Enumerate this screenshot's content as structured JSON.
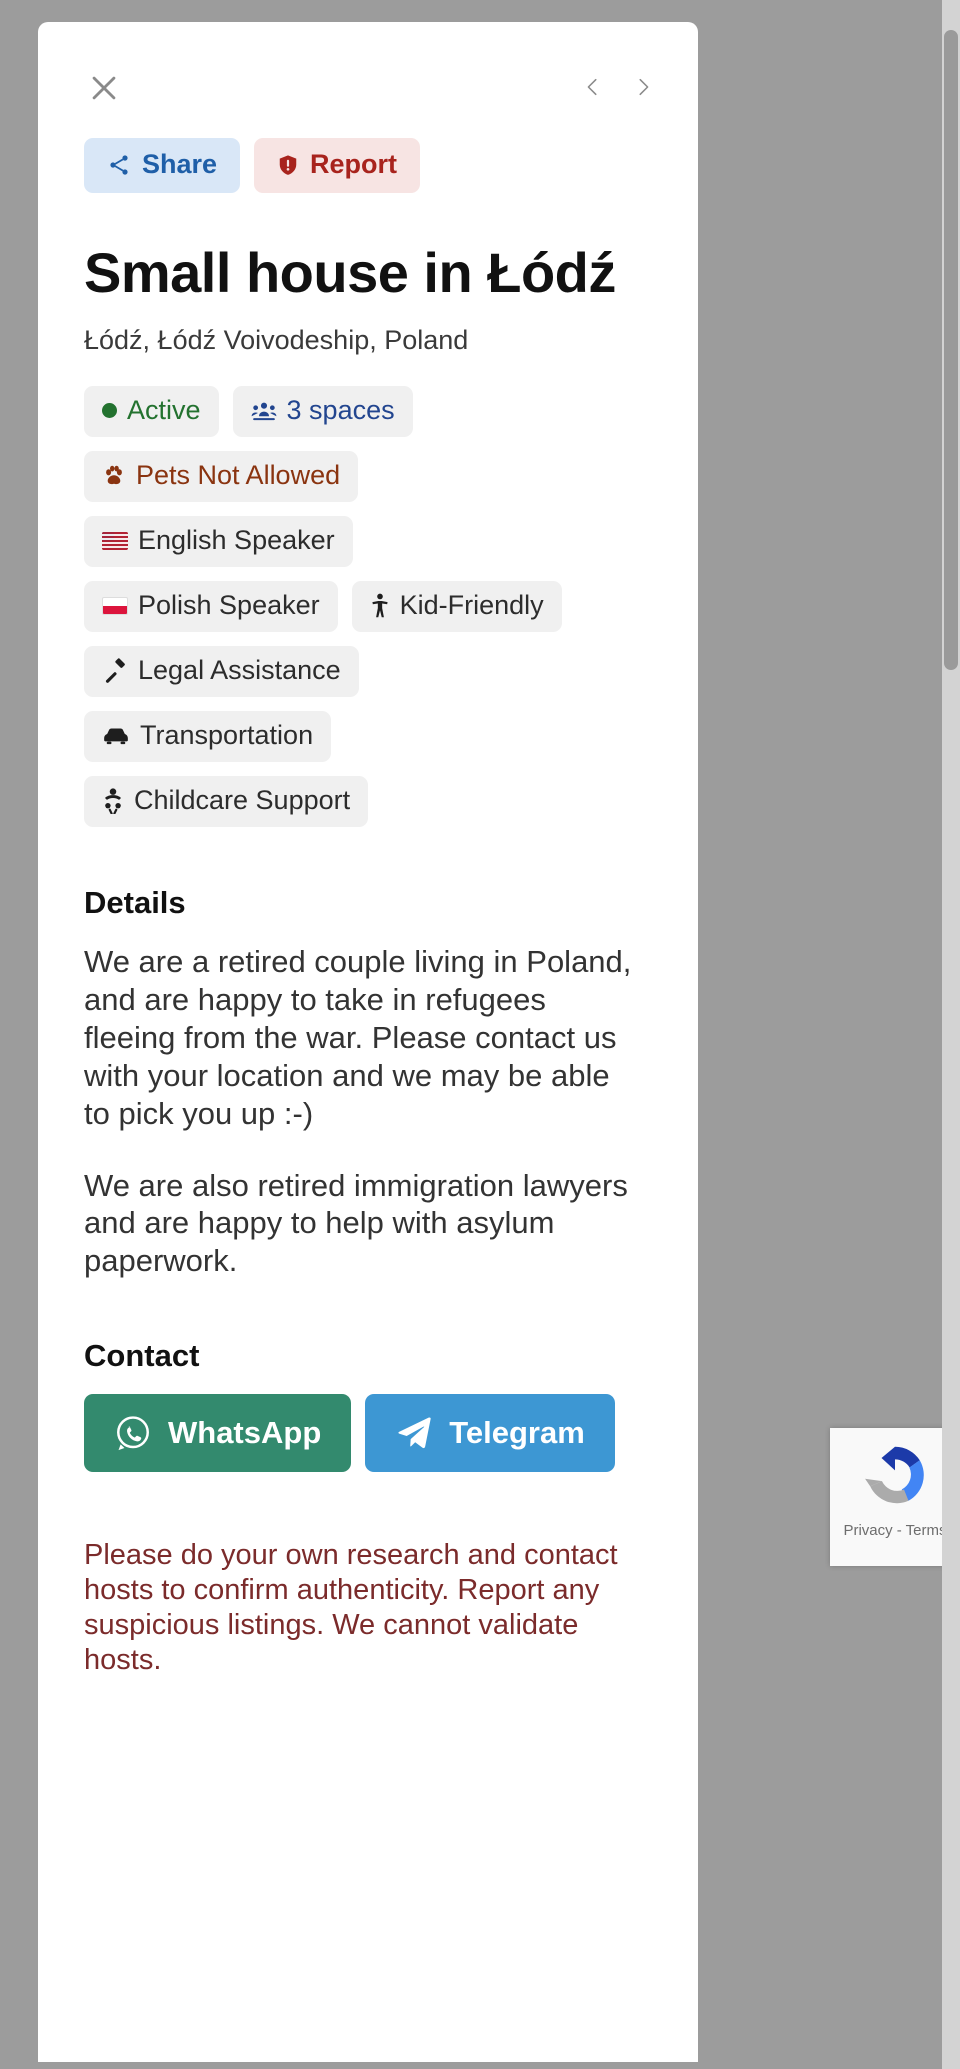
{
  "window": {
    "background_color": "#9c9c9c",
    "sheet_color": "#ffffff"
  },
  "topbar": {
    "close_label": "×",
    "close_icon": "close-icon",
    "prev_icon": "chevron-left-icon",
    "next_icon": "chevron-right-icon"
  },
  "actions": {
    "share_label": "Share",
    "share_icon": "share-icon",
    "share_color": "#1f5fa8",
    "share_bg": "#d9e7f7",
    "report_label": "Report",
    "report_icon": "shield-alert-icon",
    "report_color": "#a8231d",
    "report_bg": "#f7e4e3"
  },
  "listing": {
    "title": "Small house in Łódź",
    "location": "Łódź, Łódź Voivodeship, Poland"
  },
  "tags": [
    {
      "label": "Active",
      "icon": "green-dot-icon",
      "style": "chip-active"
    },
    {
      "label": "3 spaces",
      "icon": "people-group-icon",
      "style": "chip-spaces"
    },
    {
      "label": "Pets Not Allowed",
      "icon": "paw-icon",
      "style": "chip-pets"
    },
    {
      "label": "English Speaker",
      "icon": "flag-us-icon",
      "style": ""
    },
    {
      "label": "Polish Speaker",
      "icon": "flag-pl-icon",
      "style": ""
    },
    {
      "label": "Kid-Friendly",
      "icon": "child-icon",
      "style": ""
    },
    {
      "label": "Legal Assistance",
      "icon": "gavel-icon",
      "style": ""
    },
    {
      "label": "Transportation",
      "icon": "car-icon",
      "style": ""
    },
    {
      "label": "Childcare Support",
      "icon": "baby-icon",
      "style": ""
    }
  ],
  "details": {
    "heading": "Details",
    "paragraph1": "We are a retired couple living in Poland, and are happy to take in refugees fleeing from the war. Please contact us with your location and we may be able to pick you up :-)",
    "paragraph2": "We are also retired immigration lawyers and are happy to help with asylum paperwork."
  },
  "contact": {
    "heading": "Contact",
    "whatsapp_label": "WhatsApp",
    "whatsapp_icon": "whatsapp-icon",
    "whatsapp_color": "#338a6e",
    "telegram_label": "Telegram",
    "telegram_icon": "telegram-icon",
    "telegram_color": "#3d97d3"
  },
  "disclaimer": {
    "text": "Please do your own research and contact hosts to confirm authenticity. Report any suspicious listings. We cannot validate hosts.",
    "color": "#7b2b2b"
  },
  "recaptcha": {
    "privacy_terms": "Privacy - Terms",
    "logo_icon": "recaptcha-logo-icon"
  }
}
